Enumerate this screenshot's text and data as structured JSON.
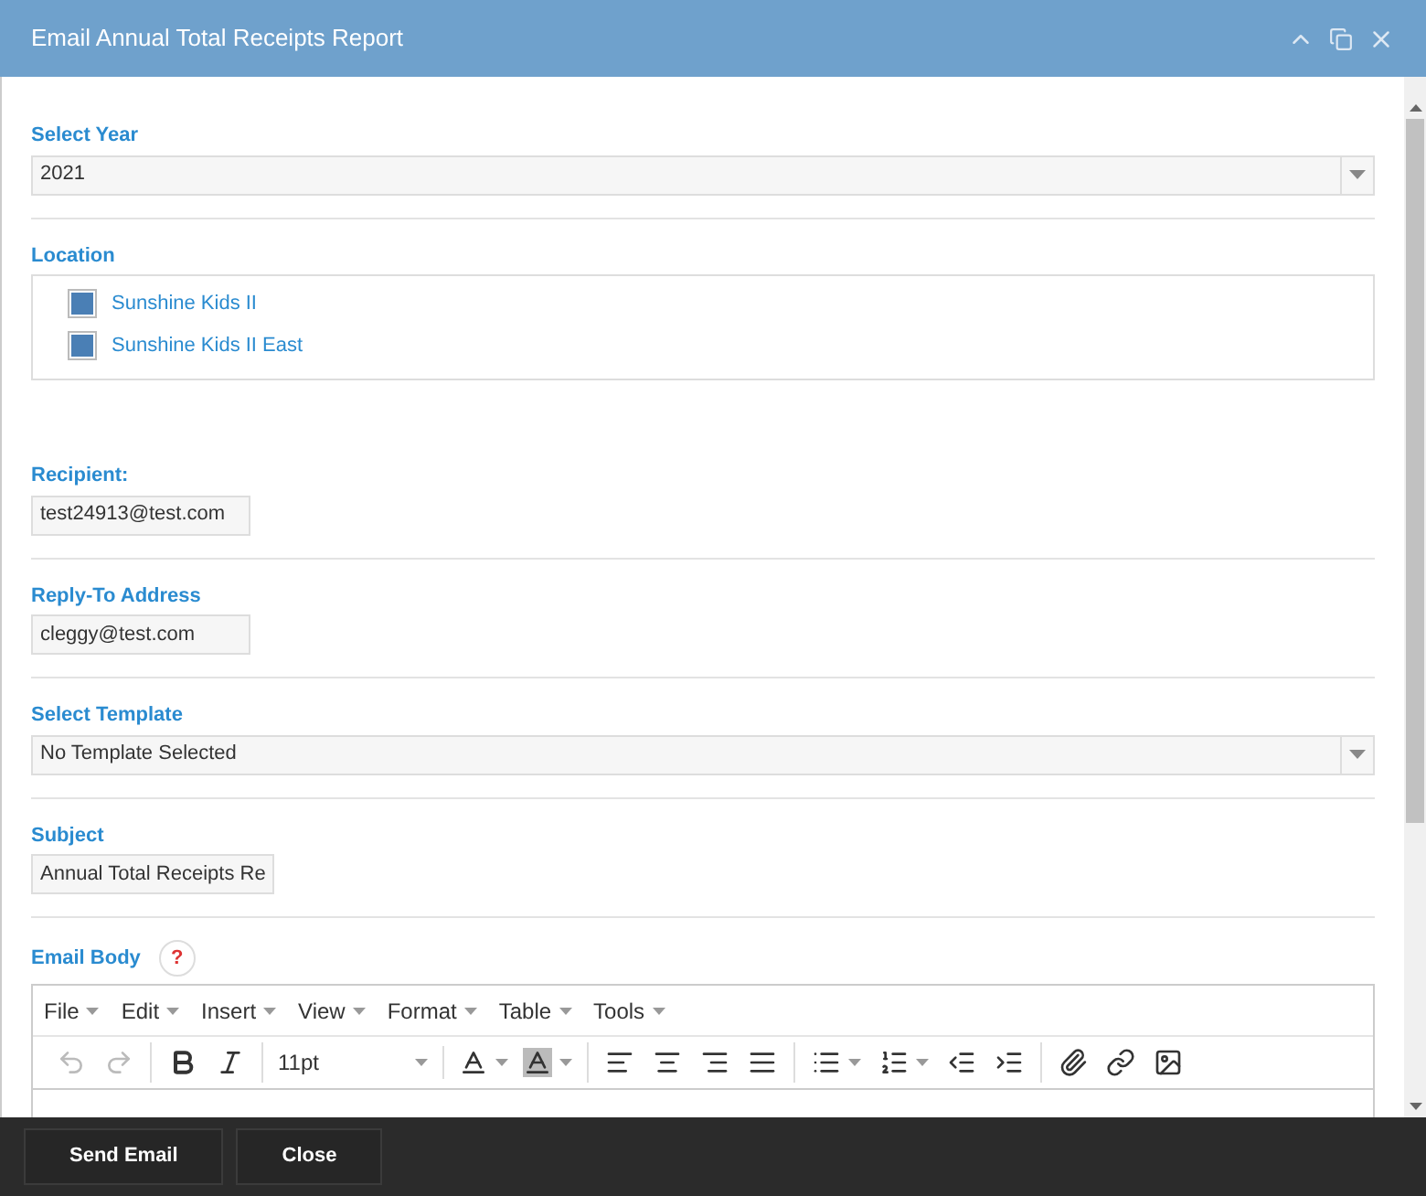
{
  "window": {
    "title": "Email Annual Total Receipts Report"
  },
  "year": {
    "label": "Select Year",
    "value": "2021"
  },
  "location": {
    "label": "Location",
    "items": [
      {
        "name": "Sunshine Kids II",
        "checked": true
      },
      {
        "name": "Sunshine Kids II East",
        "checked": true
      }
    ]
  },
  "recipient": {
    "label": "Recipient:",
    "value": "test24913@test.com"
  },
  "reply_to": {
    "label": "Reply-To Address",
    "value": "cleggy@test.com"
  },
  "template": {
    "label": "Select Template",
    "value": "No Template Selected"
  },
  "subject": {
    "label": "Subject",
    "value": "Annual Total Receipts Re"
  },
  "email_body": {
    "label": "Email Body",
    "help": "?",
    "menu": [
      "File",
      "Edit",
      "Insert",
      "View",
      "Format",
      "Table",
      "Tools"
    ],
    "toolbar": [
      [
        {
          "kind": "undo",
          "disabled": true
        },
        {
          "kind": "redo",
          "disabled": true
        }
      ],
      [
        {
          "kind": "bold",
          "disabled": false
        },
        {
          "kind": "italic",
          "disabled": false
        }
      ],
      [
        {
          "kind": "fontsize",
          "value": "11pt",
          "disabled": false
        }
      ],
      [
        {
          "kind": "textcolor",
          "disabled": false
        },
        {
          "kind": "bgcolor",
          "disabled": false
        }
      ],
      [
        {
          "kind": "alignleft",
          "disabled": false
        },
        {
          "kind": "aligncenter",
          "disabled": false
        },
        {
          "kind": "alignright",
          "disabled": false
        },
        {
          "kind": "justify",
          "disabled": false
        }
      ],
      [
        {
          "kind": "bullets",
          "disabled": false
        },
        {
          "kind": "numbers",
          "disabled": false
        },
        {
          "kind": "outdent",
          "disabled": false
        },
        {
          "kind": "indent",
          "disabled": false
        }
      ],
      [
        {
          "kind": "attach",
          "disabled": false
        },
        {
          "kind": "link",
          "disabled": false
        },
        {
          "kind": "image",
          "disabled": false
        }
      ]
    ]
  },
  "buttons": [
    "Send Email",
    "Close"
  ]
}
